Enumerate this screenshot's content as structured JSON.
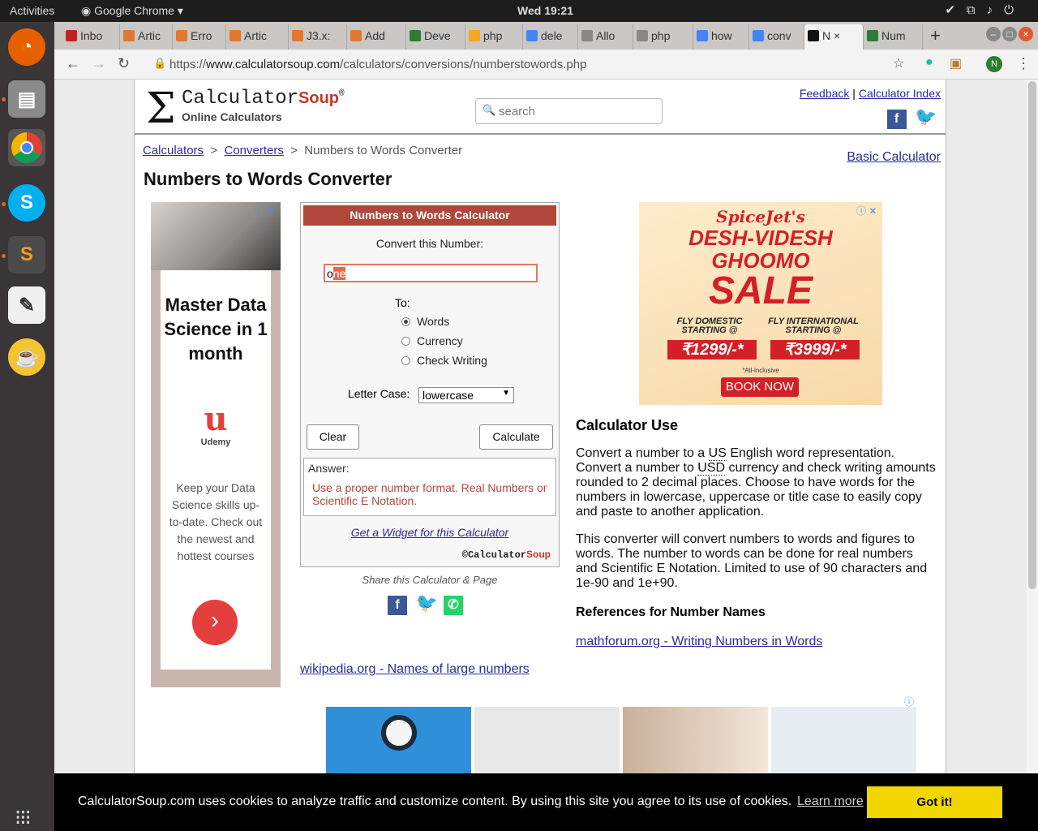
{
  "system": {
    "activities": "Activities",
    "app_name": "Google Chrome",
    "clock": "Wed 19:21"
  },
  "tabs": [
    {
      "label": "Inbo",
      "color": "#c5221f"
    },
    {
      "label": "Artic",
      "color": "#e0782f"
    },
    {
      "label": "Erro",
      "color": "#e0782f"
    },
    {
      "label": "Artic",
      "color": "#e0782f"
    },
    {
      "label": "J3.x:",
      "color": "#e0782f"
    },
    {
      "label": "Add",
      "color": "#e0782f"
    },
    {
      "label": "Deve",
      "color": "#2e7d32"
    },
    {
      "label": "php",
      "color": "#f5a623"
    },
    {
      "label": "dele",
      "color": "#4285f4"
    },
    {
      "label": "Allo",
      "color": "#888888"
    },
    {
      "label": "php",
      "color": "#888888"
    },
    {
      "label": "how",
      "color": "#4285f4"
    },
    {
      "label": "conv",
      "color": "#4285f4"
    },
    {
      "label": "N",
      "color": "#111111"
    },
    {
      "label": "Num",
      "color": "#2e7d32"
    }
  ],
  "url": {
    "scheme": "https://",
    "domain": "www.calculatorsoup.com",
    "path": "/calculators/conversions/numberstowords.php"
  },
  "profile_initial": "N",
  "header": {
    "brand_main": "Calculator",
    "brand_soup": "Soup",
    "brand_reg": "®",
    "tagline": "Online Calculators",
    "search_placeholder": "search",
    "feedback": "Feedback",
    "separator": "|",
    "index": "Calculator Index"
  },
  "breadcrumb": {
    "items": [
      "Calculators",
      "Converters"
    ],
    "current": "Numbers to Words Converter",
    "sep": ">"
  },
  "basic_calc_link": "Basic Calculator",
  "page_title": "Numbers to Words Converter",
  "ad_left": {
    "headline": "Master Data Science in 1 month",
    "brand": "Udemy",
    "brand_mark": "u",
    "desc": "Keep your Data Science skills up-to-date. Check out the newest and hottest courses",
    "arrow": "›"
  },
  "calculator": {
    "title": "Numbers to Words Calculator",
    "convert_label": "Convert this Number:",
    "input_value_plain": "o",
    "input_value_selected": "ne",
    "to_label": "To:",
    "options": [
      "Words",
      "Currency",
      "Check Writing"
    ],
    "selected_option": "Words",
    "lettercase_label": "Letter Case:",
    "lettercase_value": "lowercase",
    "clear": "Clear",
    "calculate": "Calculate",
    "answer_label": "Answer:",
    "answer_msg": "Use a proper number format. Real Numbers or Scientific E Notation.",
    "widget_link": "Get a Widget for this Calculator",
    "copyright": "©",
    "copy_brand": "Calculator",
    "copy_soup": "Soup"
  },
  "share_label": "Share this Calculator & Page",
  "ad_right": {
    "brand": "SpiceJet's",
    "line1": "DESH-VIDESH",
    "line2": "GHOOMO",
    "sale": "SALE",
    "dom_label": "FLY DOMESTIC STARTING @",
    "dom_price": "₹1299/-*",
    "intl_label": "FLY INTERNATIONAL STARTING @",
    "intl_price": "₹3999/-*",
    "inclusive": "*All-inclusive",
    "cta": "BOOK NOW"
  },
  "use": {
    "heading": "Calculator Use",
    "p1_a": "Convert a number to a ",
    "p1_us": "US",
    "p1_b": " English word representation. Convert a number to ",
    "p1_usd": "USD",
    "p1_c": " currency and check writing amounts rounded to 2 decimal places.  Choose to have words for the numbers in lowercase, uppercase or title case to easily copy and paste to another application.",
    "p2": "This converter will convert numbers to words and figures to words. The number to words can be done for real numbers and Scientific E Notation. Limited to use of 90 characters and 1e-90 and 1e+90."
  },
  "references": {
    "heading": "References for Number Names",
    "mathforum": "mathforum.org - Writing Numbers in Words",
    "wikipedia": "wikipedia.org - Names of large numbers"
  },
  "cookie": {
    "text": "CalculatorSoup.com uses cookies to analyze traffic and customize content. By using this site you agree to its use of cookies.",
    "learn": "Learn more",
    "accept": "Got it!"
  },
  "colors": {
    "accent": "#b0473a",
    "link": "#2a2aa0",
    "cookie_button": "#f1d600"
  }
}
